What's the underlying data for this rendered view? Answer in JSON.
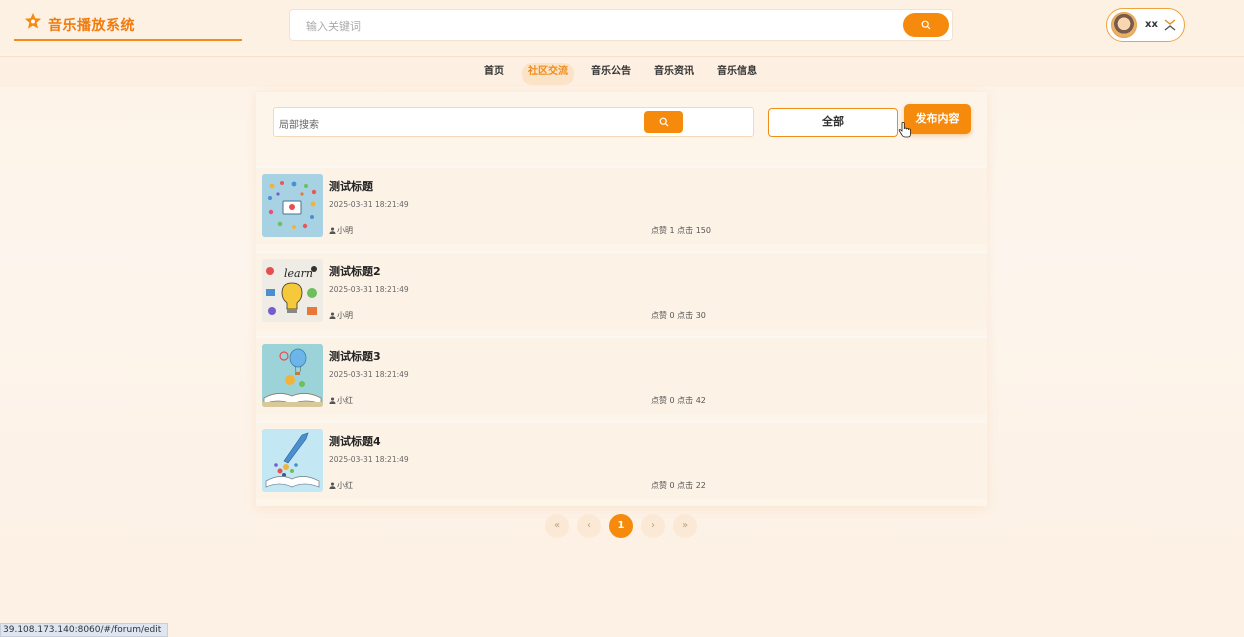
{
  "app": {
    "title": "音乐播放系统"
  },
  "header": {
    "search_placeholder": "输入关键词",
    "user_name": "xx"
  },
  "nav": {
    "items": [
      {
        "label": "首页",
        "active": false
      },
      {
        "label": "社区交流",
        "active": true
      },
      {
        "label": "音乐公告",
        "active": false
      },
      {
        "label": "音乐资讯",
        "active": false
      },
      {
        "label": "音乐信息",
        "active": false
      }
    ]
  },
  "toolbar": {
    "local_search_placeholder": "局部搜索",
    "filter_label": "全部",
    "publish_label": "发布内容"
  },
  "posts": [
    {
      "title": "测试标题",
      "date": "2025-03-31 18:21:49",
      "author": "小明",
      "stats": "点赞 1 点击 150",
      "image": "network-icons"
    },
    {
      "title": "测试标题2",
      "date": "2025-03-31 18:21:49",
      "author": "小明",
      "stats": "点赞 0 点击 30",
      "image": "learn-bulb"
    },
    {
      "title": "测试标题3",
      "date": "2025-03-31 18:21:49",
      "author": "小红",
      "stats": "点赞 0 点击 42",
      "image": "book-balloon"
    },
    {
      "title": "测试标题4",
      "date": "2025-03-31 18:21:49",
      "author": "小红",
      "stats": "点赞 0 点击 22",
      "image": "book-rocket"
    }
  ],
  "pagination": {
    "first": "«",
    "prev": "‹",
    "current": "1",
    "next": "›",
    "last": "»"
  },
  "status_bar": {
    "url": "39.108.173.140:8060/#/forum/edit"
  },
  "colors": {
    "accent": "#f58a0c",
    "brand_text": "#f07b0c",
    "background": "#fdf2e6"
  }
}
